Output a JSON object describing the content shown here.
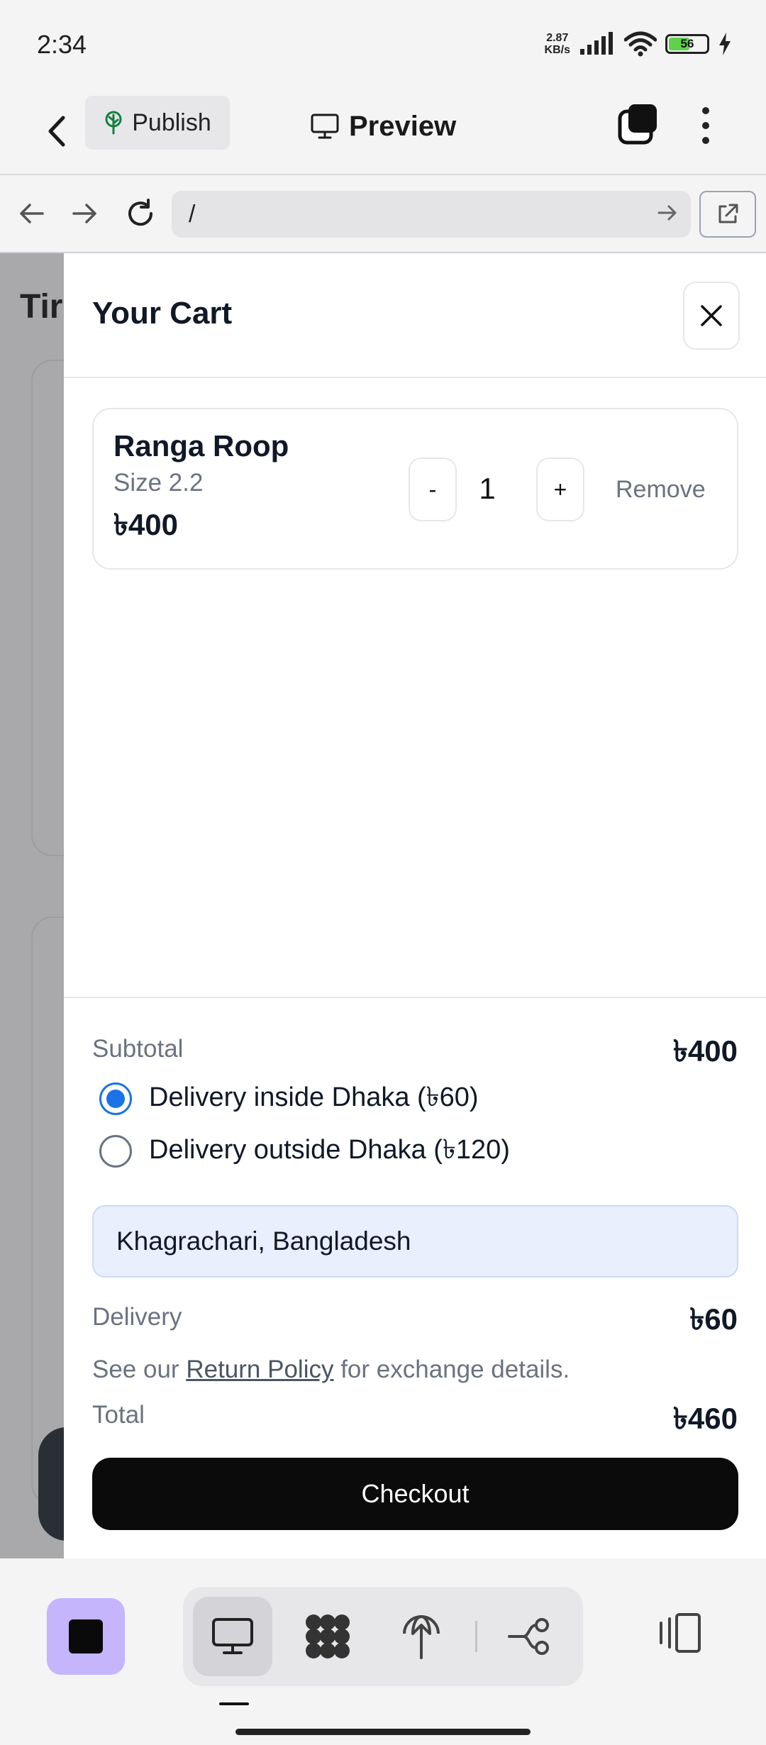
{
  "status_bar": {
    "time": "2:34",
    "net_speed_value": "2.87",
    "net_speed_unit": "KB/s",
    "battery_level": "56",
    "battery_fraction": 0.56
  },
  "toolbar": {
    "publish_label": "Publish",
    "preview_label": "Preview"
  },
  "browser": {
    "url": "/"
  },
  "background_page": {
    "title_fragment": "Tir"
  },
  "cart": {
    "title": "Your Cart",
    "item": {
      "name": "Ranga Roop",
      "size": "Size 2.2",
      "price": "৳400",
      "decrement_label": "-",
      "quantity": "1",
      "increment_label": "+",
      "remove_label": "Remove"
    },
    "subtotal_label": "Subtotal",
    "subtotal_value": "৳400",
    "delivery_options": [
      {
        "label": "Delivery inside Dhaka (৳60)",
        "selected": true
      },
      {
        "label": "Delivery outside Dhaka (৳120)",
        "selected": false
      }
    ],
    "address_value": "Khagrachari, Bangladesh",
    "delivery_label": "Delivery",
    "delivery_value": "৳60",
    "policy_prefix": "See our",
    "policy_link": "Return Policy",
    "policy_suffix": "for exchange details.",
    "total_label": "Total",
    "total_value": "৳460",
    "checkout_label": "Checkout"
  },
  "colors": {
    "accent_blue": "#1a73e8",
    "checkout_bg": "#0b0b0b",
    "address_bg": "#e8effd",
    "app_square": "#c4b5fd",
    "overlay_gray": "#a9a9ab"
  },
  "icons": {
    "back": "chevron-left-icon",
    "publish": "tree-icon",
    "preview": "monitor-icon",
    "tabs": "tabs-icon",
    "more": "more-vertical-icon",
    "close": "close-icon",
    "desktop": "monitor-icon",
    "assets": "grid-blob-icon",
    "deploy": "globe-upload-icon",
    "flow": "flow-icon",
    "device": "device-toggle-icon"
  }
}
